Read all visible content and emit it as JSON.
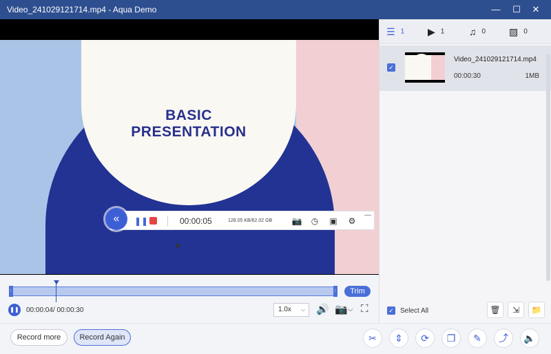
{
  "window": {
    "title": "Video_241029121714.mp4   -   Aqua Demo",
    "minimize_glyph": "—",
    "maximize_glyph": "☐",
    "close_glyph": "✕"
  },
  "preview": {
    "slide_headline_line1": "BASIC",
    "slide_headline_line2": "PRESENTATION",
    "colors": {
      "navy": "#223393",
      "cream": "#faf8f3",
      "blue": "#a9c4e6",
      "pink": "#f2cfd2"
    }
  },
  "recording_toolbar": {
    "collapse_glyph": "«",
    "pause_glyph": "❚❚",
    "elapsed": "00:00:05",
    "size_readout": "128.05 KB/62.02 GB",
    "screenshot_icon": "camera-icon",
    "timer_icon": "clock-icon",
    "toolbox_icon": "toolbox-icon",
    "settings_icon": "gear-icon",
    "minimize_glyph": "—"
  },
  "player": {
    "trim_label": "Trim",
    "time_display": "00:00:04/ 00:00:30",
    "speed_value": "1.0x",
    "speed_chevron": "⌵",
    "pause_glyph": "❚❚",
    "progress_fraction": 0.133,
    "volume_icon": "volume-icon",
    "snapshot_icon": "camera-icon",
    "fullscreen_icon": "fullscreen-icon"
  },
  "bottom_bar": {
    "record_more_label": "Record more",
    "record_again_label": "Record Again",
    "tools": [
      "scissors-icon",
      "merge-icon",
      "convert-icon",
      "copy-icon",
      "edit-icon",
      "share-icon",
      "volume-plus-icon"
    ]
  },
  "panel": {
    "tabs": [
      {
        "icon": "list-icon",
        "count": "1"
      },
      {
        "icon": "video-icon",
        "count": "1"
      },
      {
        "icon": "audio-icon",
        "count": "0"
      },
      {
        "icon": "image-icon",
        "count": "0"
      }
    ],
    "file": {
      "name": "Video_241029121714.mp4",
      "duration": "00:00:30",
      "size": "1MB"
    },
    "select_all_label": "Select All",
    "delete_icon": "trash-icon",
    "export_icon": "folder-export-icon",
    "open_folder_icon": "folder-icon"
  },
  "accent_color": "#3d5fd6"
}
